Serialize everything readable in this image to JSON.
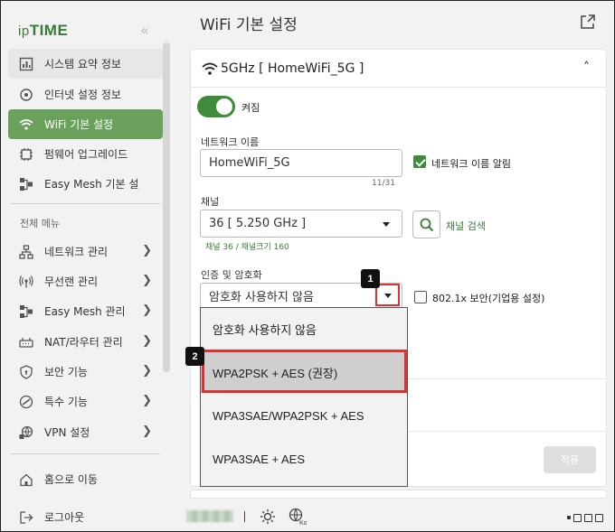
{
  "brand": {
    "logo": "ipTIME"
  },
  "page": {
    "title": "WiFi 기본 설정"
  },
  "sidebar": {
    "top_items": [
      {
        "label": "시스템 요약 정보",
        "icon": "system-summary-icon"
      },
      {
        "label": "인터넷 설정 정보",
        "icon": "internet-settings-icon"
      },
      {
        "label": "WiFi 기본 설정",
        "icon": "wifi-icon",
        "active": true
      },
      {
        "label": "펌웨어 업그레이드",
        "icon": "firmware-icon"
      },
      {
        "label": "Easy Mesh 기본 설",
        "icon": "mesh-icon"
      }
    ],
    "section_title": "전체 메뉴",
    "menu_items": [
      {
        "label": "네트워크 관리",
        "icon": "network-icon"
      },
      {
        "label": "무선랜 관리",
        "icon": "wireless-icon"
      },
      {
        "label": "Easy Mesh 관리",
        "icon": "mesh-icon"
      },
      {
        "label": "NAT/라우터 관리",
        "icon": "router-icon"
      },
      {
        "label": "보안 기능",
        "icon": "shield-icon"
      },
      {
        "label": "특수 기능",
        "icon": "special-icon"
      },
      {
        "label": "VPN 설정",
        "icon": "vpn-icon"
      }
    ],
    "bottom_items": [
      {
        "label": "홈으로 이동",
        "icon": "home-icon"
      },
      {
        "label": "로그아웃",
        "icon": "logout-icon"
      }
    ]
  },
  "wifi": {
    "band_title": "5GHz [ HomeWiFi_5G ]",
    "toggle_label": "켜짐",
    "network_name_label": "네트워크 이름",
    "network_name_value": "HomeWiFi_5G",
    "network_name_counter": "11/31",
    "broadcast_label": "네트워크 이름 알림",
    "broadcast_checked": true,
    "channel_label": "채널",
    "channel_value": "36 [ 5.250 GHz ]",
    "channel_search_label": "채널 검색",
    "channel_info": "채널 36 / 채널크기 160",
    "auth_label": "인증 및 암호화",
    "auth_value": "암호화 사용하지 않음",
    "enterprise_label": "802.1x 보안(기업용 설정)",
    "enterprise_checked": false,
    "auth_options": [
      "암호화 사용하지 않음",
      "WPA2PSK + AES (권장)",
      "WPA3SAE/WPA2PSK + AES",
      "WPA3SAE + AES"
    ],
    "highlighted_option_index": 1,
    "apply_label": "적용"
  },
  "annotations": {
    "badge1": "1",
    "badge2": "2"
  },
  "footer": {
    "language_badge": "Ko"
  },
  "colors": {
    "brand_green": "#3f8a3b",
    "active_nav": "#6aa15c",
    "annotation_red": "#e03131"
  }
}
